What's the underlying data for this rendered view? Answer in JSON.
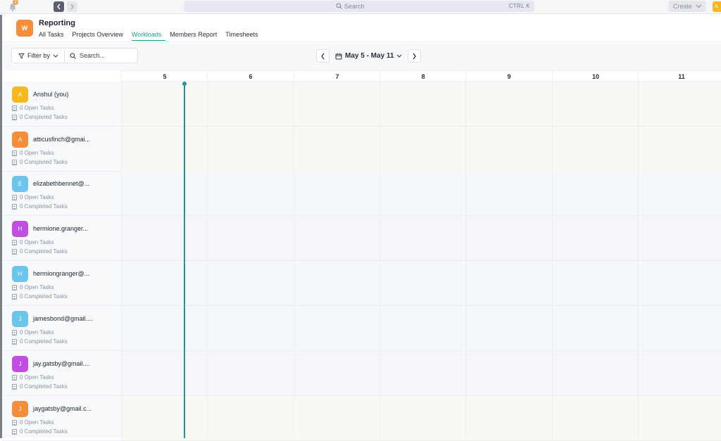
{
  "topbar": {
    "notification_count": "1",
    "search_placeholder": "Search",
    "search_shortcut": "CTRL K",
    "create_label": "Create",
    "user_initial": "A"
  },
  "header": {
    "workspace_initial": "W",
    "title": "Reporting",
    "tabs": [
      {
        "label": "All Tasks",
        "active": false
      },
      {
        "label": "Projects Overview",
        "active": false
      },
      {
        "label": "Workloads",
        "active": true
      },
      {
        "label": "Members Report",
        "active": false
      },
      {
        "label": "Timesheets",
        "active": false
      }
    ]
  },
  "toolbar": {
    "filter_label": "Filter by",
    "search_placeholder": "Search...",
    "date_range": "May 5 - May 11"
  },
  "days": [
    "5",
    "6",
    "7",
    "8",
    "9",
    "10",
    "11"
  ],
  "members": [
    {
      "initial": "A",
      "name": "Anshul (you)",
      "color": "#f5b91d",
      "open": "0 Open Tasks",
      "completed": "0 Completed Tasks",
      "row_tint": "#f9f8f5"
    },
    {
      "initial": "A",
      "name": "atticusfinch@gmai...",
      "color": "#f58e3b",
      "open": "0 Open Tasks",
      "completed": "0 Completed Tasks",
      "row_tint": "#f9f8f5"
    },
    {
      "initial": "E",
      "name": "elizabethbennet@...",
      "color": "#6ec5ec",
      "open": "0 Open Tasks",
      "completed": "0 Completed Tasks",
      "row_tint": "#f5f8fb"
    },
    {
      "initial": "H",
      "name": "hermione.granger...",
      "color": "#c14de3",
      "open": "0 Open Tasks",
      "completed": "0 Completed Tasks",
      "row_tint": "#f8f5fa"
    },
    {
      "initial": "H",
      "name": "hermiongranger@...",
      "color": "#6ec5ec",
      "open": "0 Open Tasks",
      "completed": "0 Completed Tasks",
      "row_tint": "#f5f8fb"
    },
    {
      "initial": "J",
      "name": "jamesbond@gmail....",
      "color": "#6ec5ec",
      "open": "0 Open Tasks",
      "completed": "0 Completed Tasks",
      "row_tint": "#f5f8fb"
    },
    {
      "initial": "J",
      "name": "jay.gatsby@gmail....",
      "color": "#c14de3",
      "open": "0 Open Tasks",
      "completed": "0 Completed Tasks",
      "row_tint": "#f8f5fa"
    },
    {
      "initial": "J",
      "name": "jaygatsby@gmail.c...",
      "color": "#f58e3b",
      "open": "0 Open Tasks",
      "completed": "0 Completed Tasks",
      "row_tint": "#f9f8f5"
    }
  ],
  "accent_color": "#1a9a94"
}
